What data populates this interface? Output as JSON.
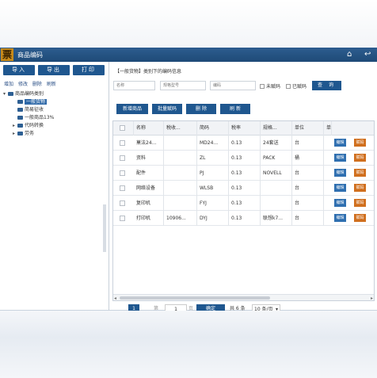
{
  "window": {
    "logo_char": "票",
    "title": "商品编码"
  },
  "toolbar": {
    "import": "导入",
    "export": "导出",
    "print": "打印"
  },
  "tree_actions": [
    "增加",
    "修改",
    "删除",
    "刷新"
  ],
  "tree": {
    "root": "商品编码类别",
    "children": [
      {
        "label": "一般货物",
        "selected": true,
        "expandable": false
      },
      {
        "label": "简易征收",
        "selected": false,
        "expandable": false
      },
      {
        "label": "一般商品13%",
        "selected": false,
        "expandable": false
      },
      {
        "label": "代码转换",
        "selected": false,
        "expandable": true
      },
      {
        "label": "劳务",
        "selected": false,
        "expandable": true
      }
    ]
  },
  "breadcrumb": "【一般货物】类别下的编码信息",
  "filters": {
    "name_placeholder": "名称",
    "spec_placeholder": "规格型号",
    "code_placeholder": "编码",
    "unassigned_label": "未赋码",
    "assigned_label": "已赋码",
    "query_label": "查 询"
  },
  "actions": {
    "add": "新增商品",
    "batch_code": "批量赋码",
    "delete": "删 除",
    "refresh": "刷 新"
  },
  "table": {
    "headers": [
      "名称",
      "税收...",
      "简码",
      "税率",
      "规格...",
      "单位",
      "单"
    ],
    "rows": [
      {
        "name": "菓法24...",
        "tax": "",
        "code": "MD24...",
        "rate": "0.13",
        "spec": "24套送",
        "unit": "台"
      },
      {
        "name": "资料",
        "tax": "",
        "code": "ZL",
        "rate": "0.13",
        "spec": "PACK",
        "unit": "桶"
      },
      {
        "name": "配件",
        "tax": "",
        "code": "PJ",
        "rate": "0.13",
        "spec": "NOVELL",
        "unit": "台"
      },
      {
        "name": "网络设备",
        "tax": "",
        "code": "WLSB",
        "rate": "0.13",
        "spec": "",
        "unit": "台"
      },
      {
        "name": "复印机",
        "tax": "",
        "code": "FYJ",
        "rate": "0.13",
        "spec": "",
        "unit": "台"
      },
      {
        "name": "打印机",
        "tax": "10906...",
        "code": "DYJ",
        "rate": "0.13",
        "spec": "联想k7...",
        "unit": "台"
      }
    ],
    "edit_label": "编辑",
    "code_label": "赋码"
  },
  "pager": {
    "current_page": "1",
    "page_prefix": "第",
    "page_input": "1",
    "page_suffix": "页",
    "confirm": "确定",
    "total": "共 6 条",
    "per_page": "10 条/页"
  },
  "colors": {
    "primary": "#1f578f",
    "edit": "#2f6fb0",
    "code": "#d06f1e",
    "titlebar": "#245383"
  }
}
